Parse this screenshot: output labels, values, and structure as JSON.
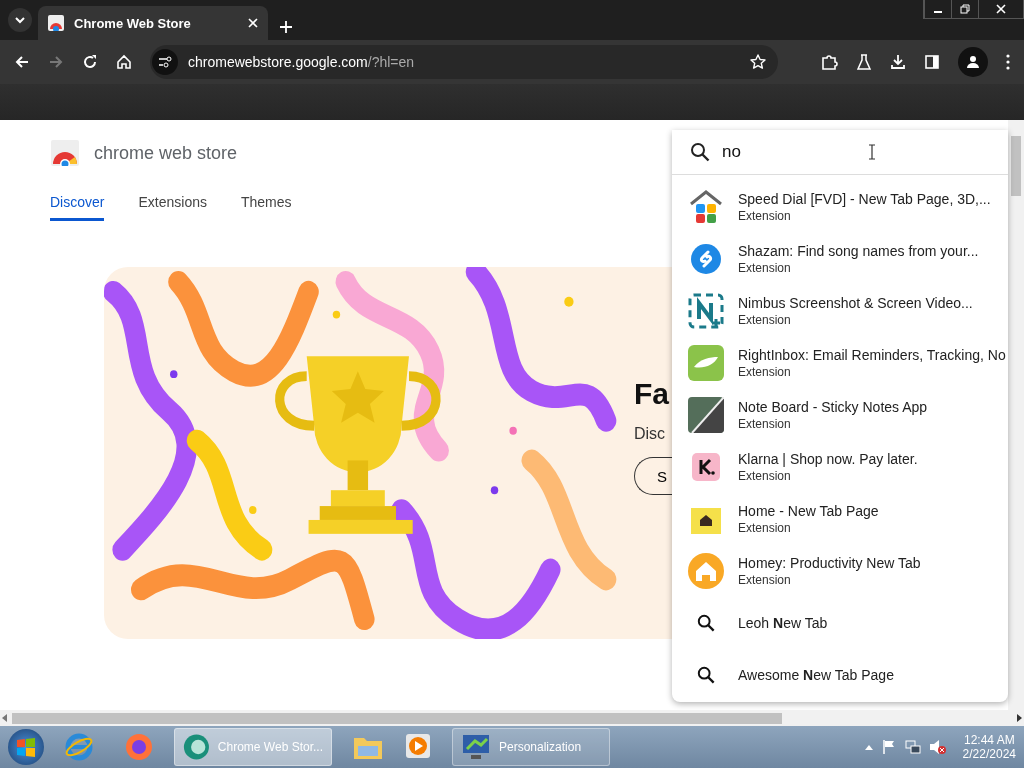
{
  "browser": {
    "tabs": [
      {
        "title": "Chrome Web Store",
        "selected": true
      }
    ],
    "address": {
      "host": "chromewebstore.google.com",
      "path": "/?hl=en"
    }
  },
  "store": {
    "logo_text": "chrome web store",
    "nav": [
      {
        "label": "Discover",
        "selected": true
      },
      {
        "label": "Extensions",
        "selected": false
      },
      {
        "label": "Themes",
        "selected": false
      }
    ],
    "hero": {
      "heading": "Fa",
      "text": "Disc",
      "button": "S"
    }
  },
  "search": {
    "value": "no",
    "results": [
      {
        "kind": "extension",
        "title": "Speed Dial [FVD] - New Tab Page, 3D,...",
        "subtitle": "Extension"
      },
      {
        "kind": "extension",
        "title": "Shazam: Find song names from your...",
        "subtitle": "Extension"
      },
      {
        "kind": "extension",
        "title": "Nimbus Screenshot & Screen Video...",
        "subtitle": "Extension"
      },
      {
        "kind": "extension",
        "title": "RightInbox: Email Reminders, Tracking, No",
        "subtitle": "Extension"
      },
      {
        "kind": "extension",
        "title": "Note Board - Sticky Notes App",
        "subtitle": "Extension"
      },
      {
        "kind": "extension",
        "title": "Klarna | Shop now. Pay later.",
        "subtitle": "Extension"
      },
      {
        "kind": "extension",
        "title": "Home - New Tab Page",
        "subtitle": "Extension"
      },
      {
        "kind": "extension",
        "title": "Homey: Productivity New Tab",
        "subtitle": "Extension"
      },
      {
        "kind": "query",
        "title": "Leoh **N**ew Tab"
      },
      {
        "kind": "query",
        "title": "Awesome **N**ew Tab Page"
      }
    ]
  },
  "taskbar": {
    "buttons": [
      {
        "label": "Chrome Web Stor...",
        "selected": true
      },
      {
        "label": "Personalization",
        "selected": false
      }
    ],
    "time": "12:44 AM",
    "date": "2/22/2024"
  }
}
